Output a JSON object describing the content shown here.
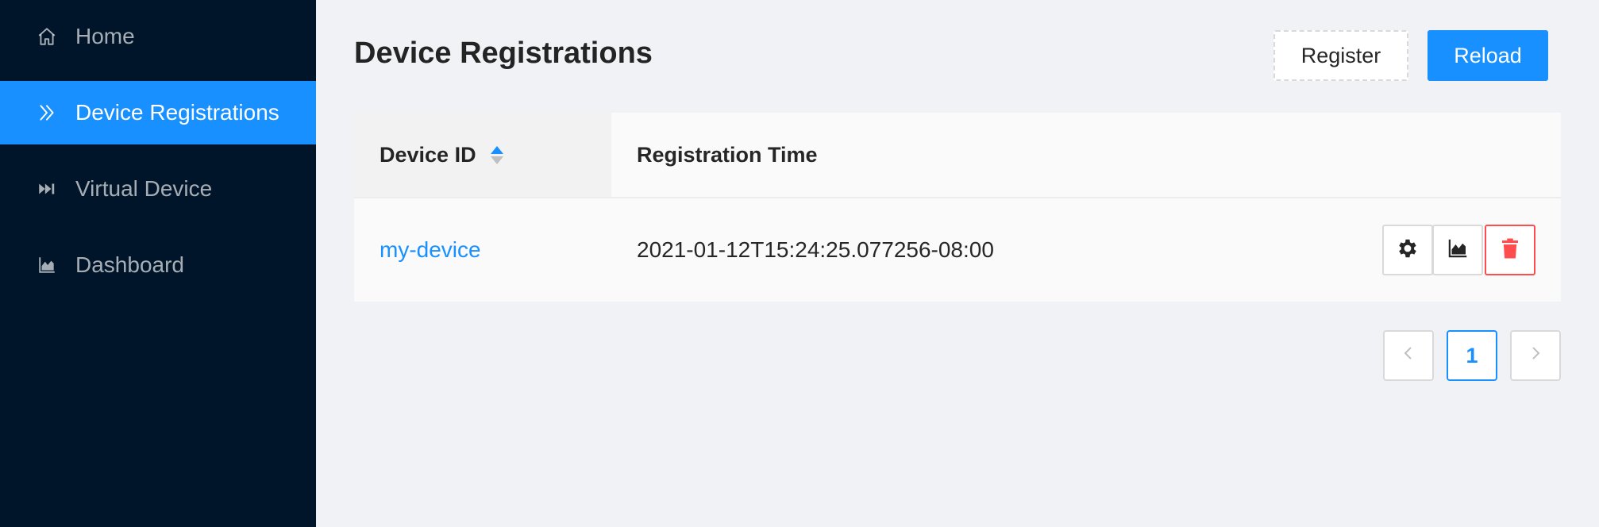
{
  "sidebar": {
    "items": [
      {
        "label": "Home",
        "icon": "home-icon",
        "active": false
      },
      {
        "label": "Device Registrations",
        "icon": "double-chevron-right-icon",
        "active": true
      },
      {
        "label": "Virtual Device",
        "icon": "fast-forward-icon",
        "active": false
      },
      {
        "label": "Dashboard",
        "icon": "area-chart-icon",
        "active": false
      }
    ]
  },
  "header": {
    "title": "Device Registrations",
    "register_label": "Register",
    "reload_label": "Reload"
  },
  "table": {
    "columns": [
      "Device ID",
      "Registration Time"
    ],
    "rows": [
      {
        "device_id": "my-device",
        "registration_time": "2021-01-12T15:24:25.077256-08:00"
      }
    ],
    "row_actions": [
      "settings-icon",
      "area-chart-icon",
      "delete-icon"
    ]
  },
  "pagination": {
    "current_page": "1"
  },
  "colors": {
    "sidebar_bg": "#001529",
    "primary": "#1890ff",
    "danger": "#ff4d4f",
    "page_bg": "#f0f2f5"
  }
}
